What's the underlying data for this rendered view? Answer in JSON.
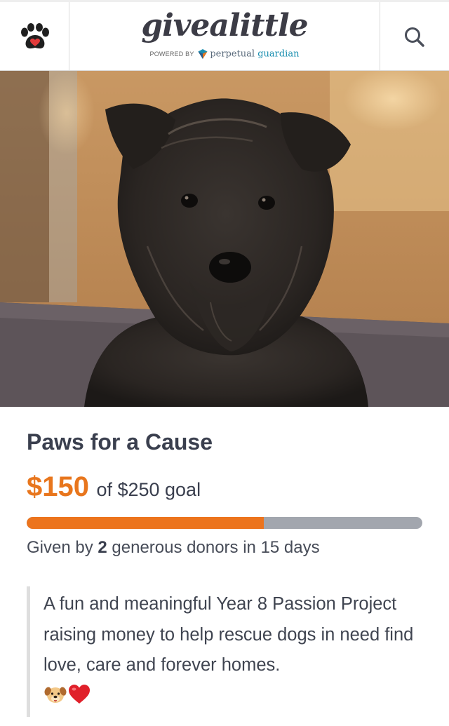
{
  "header": {
    "menu_icon": "paw-icon",
    "brand_name": "givealittle",
    "powered_by": "POWERED BY",
    "partner_part1": "perpetual ",
    "partner_part2": "guardian",
    "search_icon": "search-icon"
  },
  "hero": {
    "image": "photo of a dark shaggy terrier dog"
  },
  "campaign": {
    "title": "Paws for a Cause",
    "raised": "$150",
    "goal_text": "of $250 goal",
    "progress_fraction": 0.6,
    "donors_prefix": "Given by ",
    "donors_count": "2",
    "donors_suffix": " generous donors in 15 days",
    "description": "A fun and meaningful Year 8 Passion Project raising money to help rescue dogs in need find love, care and forever homes.",
    "emojis": [
      "dog-face-emoji",
      "red-heart-emoji"
    ]
  },
  "colors": {
    "accent_orange": "#ec741d",
    "track_gray": "#a2a6ae",
    "text_dark": "#3a3f4e",
    "paw_heart_red": "#e23a3a"
  }
}
